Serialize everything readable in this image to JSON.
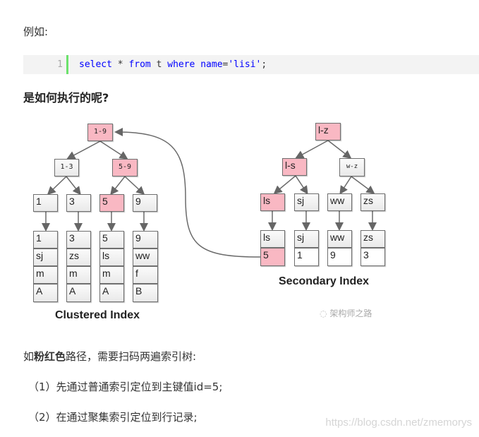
{
  "intro": "例如:",
  "code": {
    "line_number": "1",
    "tokens": {
      "select": "select",
      "star": " * ",
      "from": "from",
      "t": " t ",
      "where": "where",
      "space": " ",
      "name": "name",
      "eq": "=",
      "literal": "'lisi'",
      "semi": ";"
    }
  },
  "question": "是如何执行的呢?",
  "diagram": {
    "clustered": {
      "root": "1-9",
      "internal": [
        "1-3",
        "5-9"
      ],
      "leaves": [
        "1",
        "3",
        "5",
        "9"
      ],
      "rows": [
        [
          "1",
          "sj",
          "m",
          "A"
        ],
        [
          "3",
          "zs",
          "m",
          "A"
        ],
        [
          "5",
          "ls",
          "m",
          "A"
        ],
        [
          "9",
          "ww",
          "f",
          "B"
        ]
      ],
      "caption": "Clustered Index"
    },
    "secondary": {
      "root": "l-z",
      "internal": [
        "l-s",
        "w-z"
      ],
      "leaves": [
        "ls",
        "sj",
        "ww",
        "zs"
      ],
      "rows": [
        [
          "ls",
          "5"
        ],
        [
          "sj",
          "1"
        ],
        [
          "ww",
          "9"
        ],
        [
          "zs",
          "3"
        ]
      ],
      "caption": "Secondary Index"
    },
    "highlight_color": "#f9b8c3",
    "watermark": "架构师之路"
  },
  "summary": {
    "prefix": "如",
    "bold": "粉红色",
    "suffix": "路径，需要扫码两遍索引树:"
  },
  "steps": [
    "（1）先通过普通索引定位到主键值id=5;",
    "（2）在通过聚集索引定位到行记录;"
  ],
  "site_watermark": "https://blog.csdn.net/zmemorys"
}
